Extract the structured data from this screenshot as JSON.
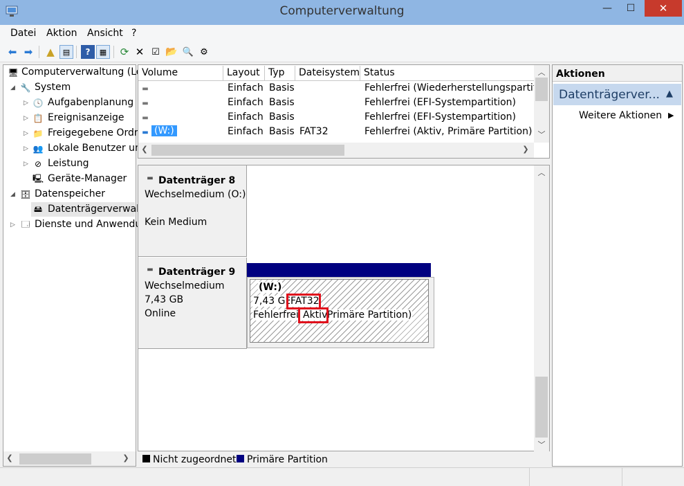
{
  "window": {
    "title": "Computerverwaltung",
    "minimize_glyph": "—",
    "maximize_glyph": "☐",
    "close_glyph": "✕"
  },
  "menu": [
    "Datei",
    "Aktion",
    "Ansicht",
    "?"
  ],
  "tree": {
    "root": "Computerverwaltung (Lo",
    "system": "System",
    "aufgaben": "Aufgabenplanung",
    "ereignis": "Ereignisanzeige",
    "freigegeben": "Freigegebene Ordr",
    "lokale": "Lokale Benutzer un",
    "leistung": "Leistung",
    "geraete": "Geräte-Manager",
    "datenspeicher": "Datenspeicher",
    "datentraeger": "Datenträgerverwalt",
    "dienste": "Dienste und Anwendu"
  },
  "volumes": {
    "headers": [
      "Volume",
      "Layout",
      "Typ",
      "Dateisystem",
      "Status"
    ],
    "rows": [
      {
        "volume": "",
        "layout": "Einfach",
        "typ": "Basis",
        "fs": "",
        "status": "Fehlerfrei (Wiederherstellungspartitic"
      },
      {
        "volume": "",
        "layout": "Einfach",
        "typ": "Basis",
        "fs": "",
        "status": "Fehlerfrei (EFI-Systempartition)"
      },
      {
        "volume": "",
        "layout": "Einfach",
        "typ": "Basis",
        "fs": "",
        "status": "Fehlerfrei (EFI-Systempartition)"
      },
      {
        "volume": "(W:)",
        "layout": "Einfach",
        "typ": "Basis",
        "fs": "FAT32",
        "status": "Fehlerfrei (Aktiv, Primäre Partition)"
      }
    ]
  },
  "disks": {
    "d8": {
      "name": "Datenträger 8",
      "type": "Wechselmedium (O:)",
      "status": "Kein Medium"
    },
    "d9": {
      "name": "Datenträger 9",
      "type": "Wechselmedium",
      "size": "7,43 GB",
      "status": "Online",
      "partition": {
        "label": "(W:)",
        "size": "7,43 GB",
        "fs": "FAT32",
        "status_prefix": "Fehlerfrei (",
        "status_active": "Aktiv,",
        "status_suffix": " Primäre Partition)"
      }
    }
  },
  "legend": {
    "unallocated": "Nicht zugeordnet",
    "primary": "Primäre Partition"
  },
  "actions": {
    "title": "Aktionen",
    "section": "Datenträgerver...",
    "more": "Weitere Aktionen"
  },
  "colors": {
    "titlebar": "#8fb6e3",
    "close": "#c73a2c",
    "primary_partition": "#000080",
    "selection": "#3399ff",
    "highlight": "#e0101c"
  }
}
